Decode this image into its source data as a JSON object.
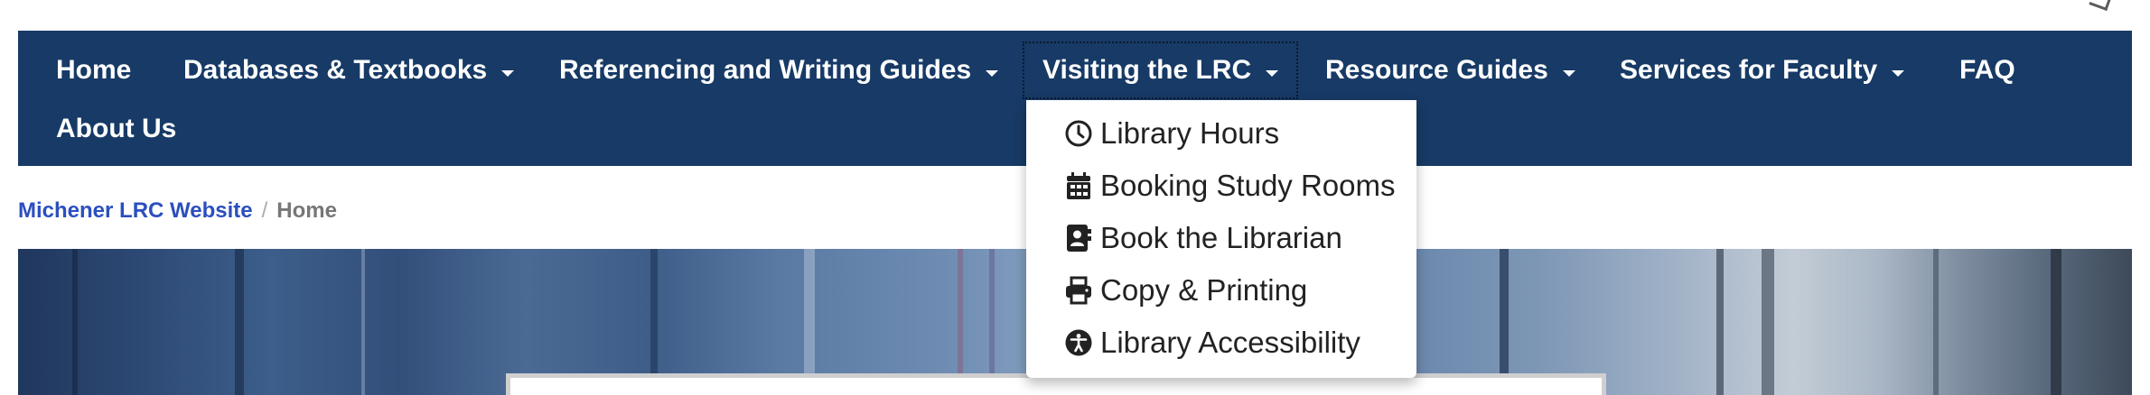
{
  "nav": {
    "items": [
      {
        "label": "Home",
        "has_caret": false
      },
      {
        "label": "Databases & Textbooks",
        "has_caret": true
      },
      {
        "label": "Referencing and Writing Guides",
        "has_caret": true
      },
      {
        "label": "Visiting the LRC",
        "has_caret": true,
        "expanded": true
      },
      {
        "label": "Resource Guides",
        "has_caret": true
      },
      {
        "label": "Services for Faculty",
        "has_caret": true
      },
      {
        "label": "FAQ",
        "has_caret": false
      },
      {
        "label": "About Us",
        "has_caret": false
      }
    ],
    "background_color": "#173a66"
  },
  "dropdown": {
    "items": [
      {
        "label": "Library Hours",
        "icon": "clock-icon"
      },
      {
        "label": "Booking Study Rooms",
        "icon": "calendar-icon"
      },
      {
        "label": "Book the Librarian",
        "icon": "contact-book-icon"
      },
      {
        "label": "Copy & Printing",
        "icon": "printer-icon"
      },
      {
        "label": "Library Accessibility",
        "icon": "accessibility-icon"
      }
    ]
  },
  "breadcrumb": {
    "link": "Michener LRC Website",
    "separator": "/",
    "current": "Home",
    "link_color": "#2b4fbf"
  }
}
